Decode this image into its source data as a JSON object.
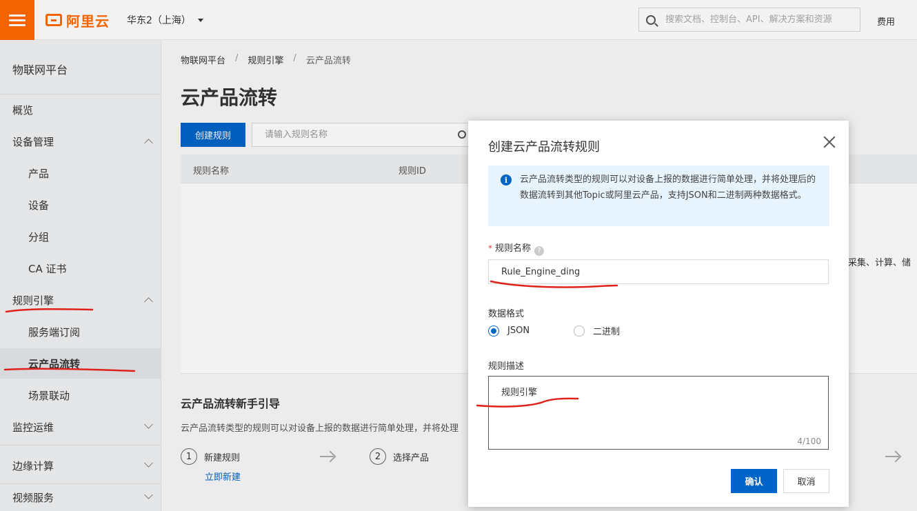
{
  "topbar": {
    "logo_text": "阿里云",
    "region": "华东2（上海）",
    "search_placeholder": "搜索文档、控制台、API、解决方案和资源",
    "fee_label": "费用",
    "brand_color": "#ff6a00"
  },
  "sidebar": {
    "title": "物联网平台",
    "items": [
      {
        "label": "概览"
      },
      {
        "label": "设备管理"
      },
      {
        "label": "产品"
      },
      {
        "label": "设备"
      },
      {
        "label": "分组"
      },
      {
        "label": "CA 证书"
      },
      {
        "label": "规则引擎"
      },
      {
        "label": "服务端订阅"
      },
      {
        "label": "云产品流转"
      },
      {
        "label": "场景联动"
      },
      {
        "label": "监控运维"
      },
      {
        "label": "边缘计算"
      },
      {
        "label": "视频服务"
      }
    ]
  },
  "main": {
    "breadcrumb": [
      "物联网平台",
      "规则引擎",
      "云产品流转"
    ],
    "breadcrumb_sep": "/",
    "page_title": "云产品流转",
    "create_button": "创建规则",
    "search_placeholder": "请输入规则名称",
    "table_headers": [
      "规则名称",
      "规则ID"
    ],
    "right_snippet": "采集、计算、储",
    "guide_title": "云产品流转新手引导",
    "guide_desc": "云产品流转类型的规则可以对设备上报的数据进行简单处理，并将处理",
    "steps": [
      {
        "num": "1",
        "label": "新建规则",
        "link": "立即新建"
      },
      {
        "num": "2",
        "label": "选择产品"
      }
    ]
  },
  "dialog": {
    "title": "创建云产品流转规则",
    "notice": "云产品流转类型的规则可以对设备上报的数据进行简单处理，并将处理后的数据流转到其他Topic或阿里云产品，支持JSON和二进制两种数据格式。",
    "name_label": "规则名称",
    "required_mark": "*",
    "help_glyph": "?",
    "name_value": "Rule_Engine_ding",
    "format_label": "数据格式",
    "format_options": [
      "JSON",
      "二进制"
    ],
    "format_selected": "JSON",
    "desc_label": "规则描述",
    "desc_value": "规则引擎",
    "desc_counter": "4/100",
    "ok_button": "确认",
    "cancel_button": "取消",
    "primary_color": "#0064c8"
  }
}
